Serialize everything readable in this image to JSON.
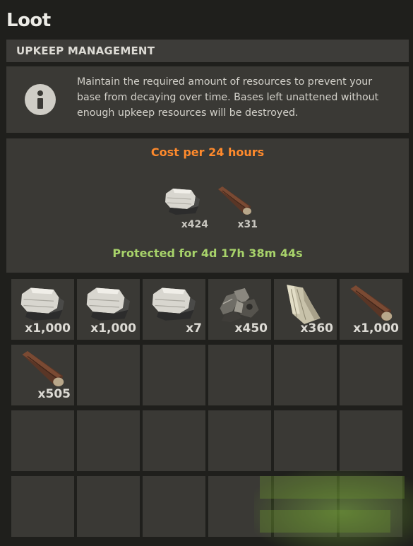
{
  "window": {
    "title": "Loot"
  },
  "upkeep": {
    "header": "UPKEEP MANAGEMENT",
    "info_text": "Maintain the required amount of resources to prevent your base from decaying over time. Bases left unattened without enough upkeep resources will be destroyed.",
    "cost_title": "Cost per 24 hours",
    "cost_items": [
      {
        "icon": "stone-icon",
        "qty": "x424"
      },
      {
        "icon": "wood-icon",
        "qty": "x31"
      }
    ],
    "protected_text": "Protected for 4d 17h 38m 44s"
  },
  "inventory": {
    "slots": [
      {
        "icon": "stone-icon",
        "qty": "x1,000"
      },
      {
        "icon": "stone-icon",
        "qty": "x1,000"
      },
      {
        "icon": "stone-icon",
        "qty": "x7"
      },
      {
        "icon": "metal-fragments-icon",
        "qty": "x450"
      },
      {
        "icon": "cloth-icon",
        "qty": "x360"
      },
      {
        "icon": "wood-icon",
        "qty": "x1,000"
      },
      {
        "icon": "wood-icon",
        "qty": "x505"
      }
    ]
  },
  "colors": {
    "cost_title": "#ff8a2c",
    "protected": "#a7d26a",
    "panel": "#3a3935",
    "background": "#1f1f1c"
  }
}
